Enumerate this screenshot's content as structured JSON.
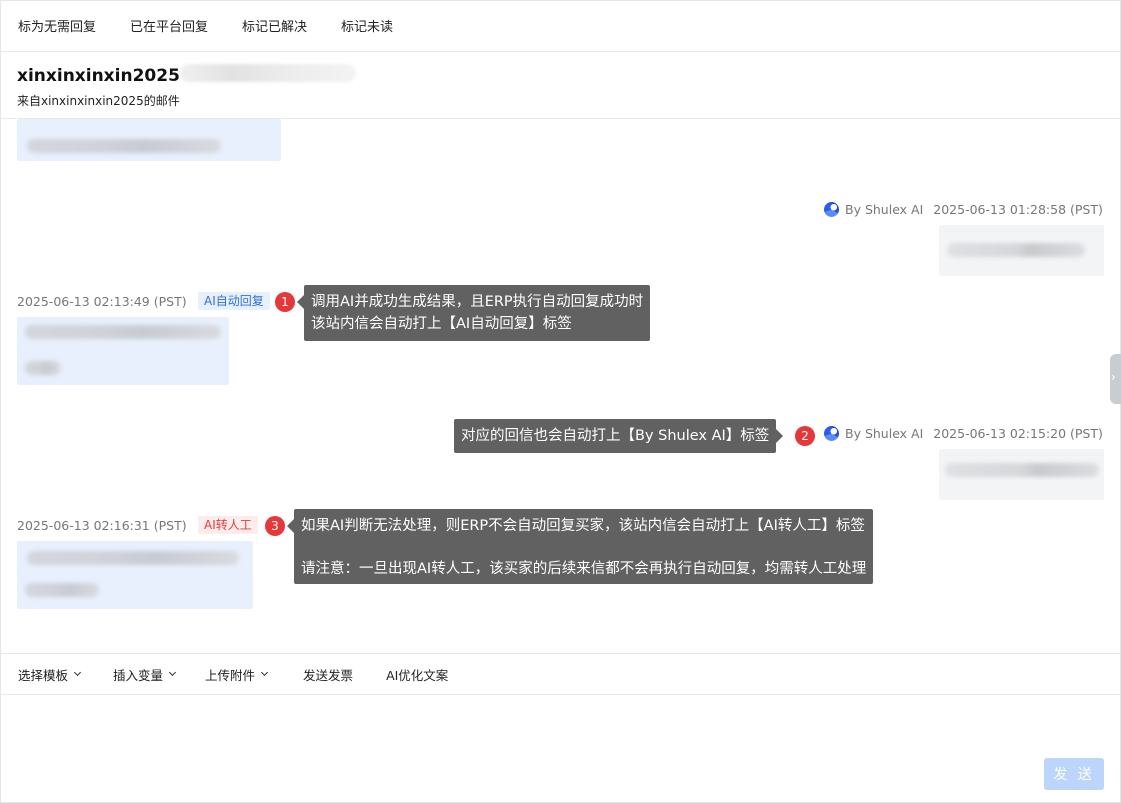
{
  "top_actions": [
    "标为无需回复",
    "已在平台回复",
    "标记已解决",
    "标记未读"
  ],
  "header": {
    "name": "xinxinxinxin2025",
    "subtitle": "来自xinxinxinxin2025的邮件"
  },
  "messages": {
    "out1": {
      "signature": "By Shulex AI",
      "timestamp": "2025-06-13 01:28:58 (PST)"
    },
    "in1": {
      "timestamp": "2025-06-13 02:13:49 (PST)",
      "tag": "AI自动回复"
    },
    "out2": {
      "signature": "By Shulex AI",
      "timestamp": "2025-06-13 02:15:20 (PST)"
    },
    "in2": {
      "timestamp": "2025-06-13 02:16:31 (PST)",
      "tag": "AI转人工"
    }
  },
  "annotations": {
    "a1": {
      "number": "1",
      "line1": "调用AI并成功生成结果，且ERP执行自动回复成功时",
      "line2": "该站内信会自动打上【AI自动回复】标签"
    },
    "a2": {
      "number": "2",
      "line1": "对应的回信也会自动打上【By Shulex AI】标签"
    },
    "a3": {
      "number": "3",
      "line1": "如果AI判断无法处理，则ERP不会自动回复买家，该站内信会自动打上【AI转人工】标签",
      "line2": "请注意：一旦出现AI转人工，该买家的后续来信都不会再执行自动回复，均需转人工处理"
    }
  },
  "toolbar": {
    "template": "选择模板",
    "variable": "插入变量",
    "attachment": "上传附件",
    "invoice": "发送发票",
    "ai_optimize": "AI优化文案"
  },
  "send_label": "发 送",
  "colors": {
    "ai_tag": "#2f6fde",
    "human_tag": "#e53b3b",
    "badge": "#e5383b",
    "tooltip": "#616161",
    "send_disabled": "#bcd5fb"
  }
}
